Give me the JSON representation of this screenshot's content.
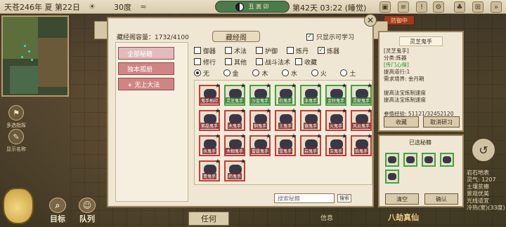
{
  "top_bar": {
    "date": "天苍246年 夏 第22日",
    "temperature": "30度",
    "time_pill": "丑 寅 卯",
    "turn_time": "第42天 03:22 (睡觉)",
    "notice": "防御中"
  },
  "side_buttons": {
    "multi_select": "多选指挥",
    "show_names": "显示名称"
  },
  "bottom": {
    "target": "目标",
    "team": "队列",
    "task": "任何",
    "info": "信息",
    "deity": "八劫真仙"
  },
  "terrain": [
    "岩石地表",
    "灵气: 1207",
    "土壤贫瘠",
    "景观优美",
    "光线适宜",
    "冷热(室)(33度)"
  ],
  "panel": {
    "title": "藏经阁",
    "count_label": "藏经阁容量：1732/4100",
    "only_learnable": "只显示可学习",
    "close_label": "✕",
    "search_placeholder": "搜索秘籍",
    "search_button": "搜索"
  },
  "categories": [
    {
      "label": "全部秘籍",
      "active": true
    },
    {
      "label": "独本孤册",
      "active": false
    },
    {
      "label": "+ 无上大法",
      "active": false
    }
  ],
  "filters": {
    "row1": [
      {
        "label": "御器",
        "checked": false
      },
      {
        "label": "术法",
        "checked": false
      },
      {
        "label": "护御",
        "checked": false
      },
      {
        "label": "炼丹",
        "checked": false
      },
      {
        "label": "炼器",
        "checked": true
      }
    ],
    "row2": [
      {
        "label": "修行",
        "checked": false
      },
      {
        "label": "其他",
        "checked": false
      },
      {
        "label": "战斗法术",
        "checked": false
      },
      {
        "label": "收藏",
        "checked": false
      }
    ],
    "elements": [
      {
        "label": "无",
        "on": true
      },
      {
        "label": "金",
        "on": false
      },
      {
        "label": "木",
        "on": false
      },
      {
        "label": "水",
        "on": false
      },
      {
        "label": "火",
        "on": false
      },
      {
        "label": "土",
        "on": false
      }
    ]
  },
  "skills": [
    {
      "label": "鬼手拓印",
      "green": false
    },
    {
      "label": "灵芝鬼手",
      "green": true
    },
    {
      "label": "沙金鬼手",
      "green": true
    },
    {
      "label": "石鬼手",
      "green": true
    },
    {
      "label": "冰鬼手",
      "green": true
    },
    {
      "label": "金铃鬼手",
      "green": true
    },
    {
      "label": "灵蛇鬼手",
      "green": true
    },
    {
      "label": "紫晶鬼手",
      "green": false
    },
    {
      "label": "木鬼手",
      "green": false
    },
    {
      "label": "铜鬼手",
      "green": false
    },
    {
      "label": "土鬼手",
      "green": false
    },
    {
      "label": "银鬼手",
      "green": false
    },
    {
      "label": "火鬼手",
      "green": false
    },
    {
      "label": "风云鬼手",
      "green": false
    },
    {
      "label": "水鬼手",
      "green": false
    },
    {
      "label": "木相鬼手",
      "green": false
    },
    {
      "label": "雷霆鬼手",
      "green": false
    },
    {
      "label": "雪鬼手",
      "green": false
    },
    {
      "label": "岩鬼手",
      "green": false
    },
    {
      "label": "玉鬼手",
      "green": false
    },
    {
      "label": "焰鬼手",
      "green": false
    },
    {
      "label": "青鬼手",
      "green": false
    },
    {
      "label": "药鬼手",
      "green": false
    }
  ],
  "detail": {
    "title": "灵芝鬼手",
    "lines": [
      {
        "text": "[灵芝鬼手]",
        "green": false
      },
      {
        "text": "分类:炼器",
        "green": false
      },
      {
        "text": "[传门心得]",
        "green": true
      },
      {
        "text": "提高道行:1",
        "green": false
      },
      {
        "text": "需求境界: 金丹期",
        "green": false
      },
      {
        "text": "",
        "green": false
      },
      {
        "text": "提高法宝炼制速度",
        "green": false
      },
      {
        "text": "提高法宝炼制速度",
        "green": false
      },
      {
        "text": "",
        "green": false
      },
      {
        "text": "参悟经验: 51121/32452120",
        "green": false
      }
    ],
    "collect_button": "收藏",
    "study_button": "取消研习"
  },
  "selected": {
    "title": "已选秘籍",
    "clear_button": "清空",
    "confirm_button": "确认"
  }
}
